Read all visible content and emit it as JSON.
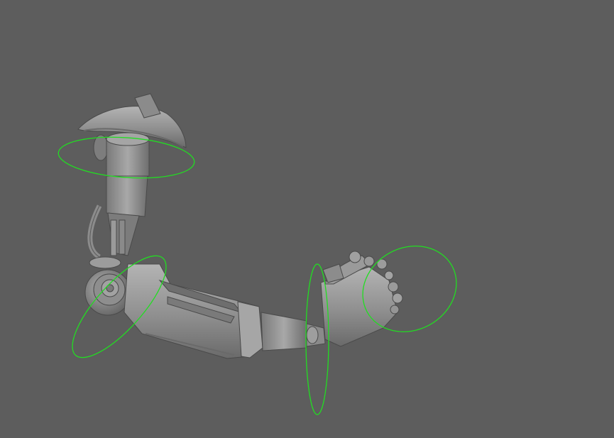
{
  "viewport": {
    "background_color": "#5d5d5d",
    "mesh_color": "#9a9a9a",
    "controller_color": "#22dd22"
  },
  "scene": {
    "model": "robotic-arm",
    "controllers": [
      {
        "name": "shoulder-rotate-controller",
        "shape": "circle"
      },
      {
        "name": "elbow-rotate-controller",
        "shape": "circle"
      },
      {
        "name": "wrist-rotate-controller",
        "shape": "circle"
      },
      {
        "name": "hand-rotate-controller",
        "shape": "circle"
      }
    ]
  }
}
